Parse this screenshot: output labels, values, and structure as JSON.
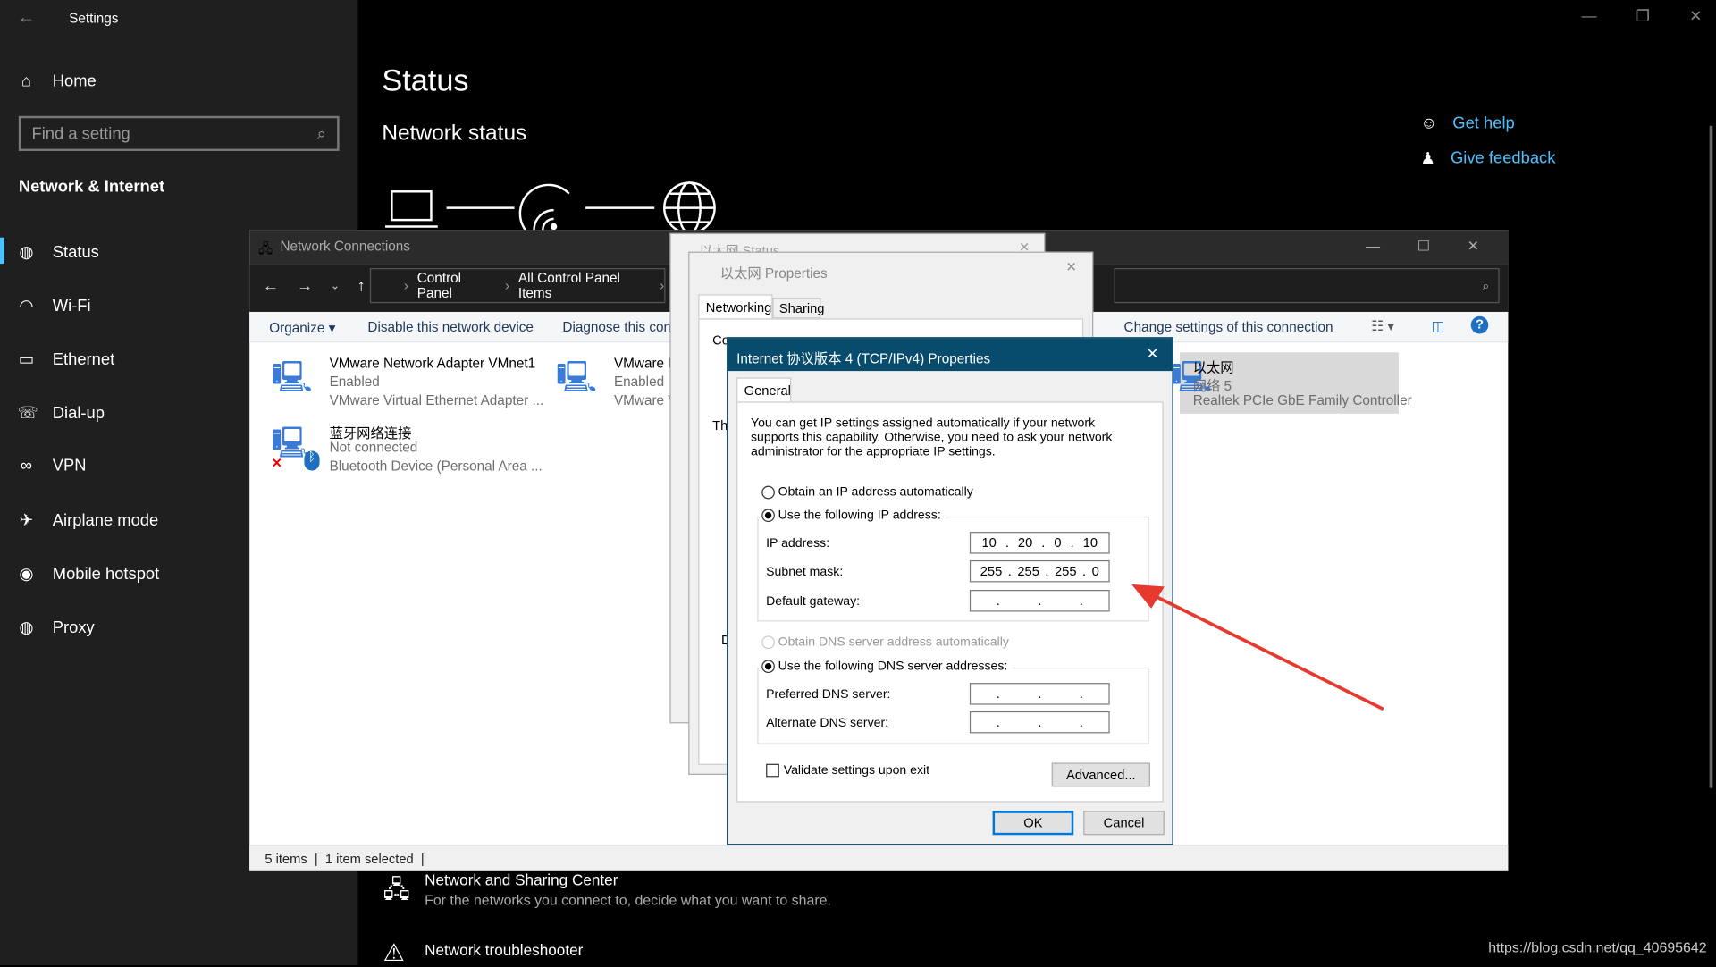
{
  "settings": {
    "title": "Settings",
    "home": "Home",
    "search_placeholder": "Find a setting",
    "section": "Network & Internet",
    "nav": [
      {
        "label": "Status",
        "icon": "globe-icon"
      },
      {
        "label": "Wi-Fi",
        "icon": "wifi-icon"
      },
      {
        "label": "Ethernet",
        "icon": "ethernet-icon"
      },
      {
        "label": "Dial-up",
        "icon": "dialup-icon"
      },
      {
        "label": "VPN",
        "icon": "vpn-icon"
      },
      {
        "label": "Airplane mode",
        "icon": "airplane-icon"
      },
      {
        "label": "Mobile hotspot",
        "icon": "hotspot-icon"
      },
      {
        "label": "Proxy",
        "icon": "proxy-icon"
      }
    ],
    "page_title": "Status",
    "network_status": "Network status",
    "get_help": "Get help",
    "give_feedback": "Give feedback",
    "sharing_center": {
      "title": "Network and Sharing Center",
      "desc": "For the networks you connect to, decide what you want to share."
    },
    "troubleshooter": "Network troubleshooter",
    "accent": "#4cc2ff"
  },
  "netconn": {
    "title": "Network Connections",
    "breadcrumb": [
      "Control Panel",
      "All Control Panel Items"
    ],
    "toolbar": [
      "Organize ▾",
      "Disable this network device",
      "Diagnose this conn",
      "Change settings of this connection"
    ],
    "items": [
      {
        "name": "VMware Network Adapter VMnet1",
        "status": "Enabled",
        "device": "VMware Virtual Ethernet Adapter ..."
      },
      {
        "name": "VMware N",
        "status": "Enabled",
        "device": "VMware V"
      },
      {
        "name": "以太网",
        "status": "网络 5",
        "device": "Realtek PCIe GbE Family Controller"
      },
      {
        "name": "蓝牙网络连接",
        "status": "Not connected",
        "device": "Bluetooth Device (Personal Area ..."
      }
    ],
    "statusbar": {
      "count": "5 items",
      "selected": "1 item selected"
    }
  },
  "eth_status": {
    "title": "以太网 Status"
  },
  "eth_props": {
    "title": "以太网 Properties",
    "tabs": [
      "Networking",
      "Sharing"
    ],
    "conn_label": "Co",
    "this_label": "Th",
    "d_label": "D"
  },
  "ipv4": {
    "title": "Internet 协议版本 4 (TCP/IPv4) Properties",
    "tab": "General",
    "desc": "You can get IP settings assigned automatically if your network supports this capability. Otherwise, you need to ask your network administrator for the appropriate IP settings.",
    "auto_ip": "Obtain an IP address automatically",
    "manual_ip": "Use the following IP address:",
    "ip_label": "IP address:",
    "ip": [
      "10",
      "20",
      "0",
      "10"
    ],
    "mask_label": "Subnet mask:",
    "mask": [
      "255",
      "255",
      "255",
      "0"
    ],
    "gw_label": "Default gateway:",
    "auto_dns": "Obtain DNS server address automatically",
    "manual_dns": "Use the following DNS server addresses:",
    "pref_dns": "Preferred DNS server:",
    "alt_dns": "Alternate DNS server:",
    "validate": "Validate settings upon exit",
    "advanced": "Advanced...",
    "ok": "OK",
    "cancel": "Cancel",
    "title_color": "#074b6d"
  },
  "watermark": "https://blog.csdn.net/qq_40695642",
  "annotation_arrow_color": "#e8392f"
}
